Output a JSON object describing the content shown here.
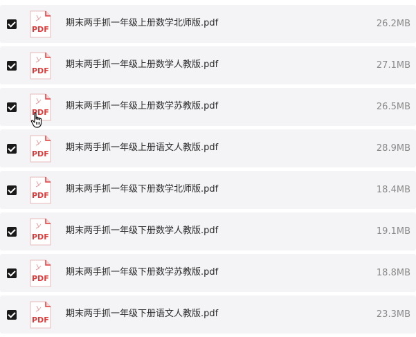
{
  "files": [
    {
      "name": "期末两手抓一年级上册数学北师版.pdf",
      "size": "26.2MB",
      "checked": true,
      "icon": "pdf-icon",
      "icon_label": "PDF"
    },
    {
      "name": "期末两手抓一年级上册数学人教版.pdf",
      "size": "27.1MB",
      "checked": true,
      "icon": "pdf-icon",
      "icon_label": "PDF"
    },
    {
      "name": "期末两手抓一年级上册数学苏教版.pdf",
      "size": "26.5MB",
      "checked": true,
      "icon": "pdf-icon",
      "icon_label": "PDF"
    },
    {
      "name": "期末两手抓一年级上册语文人教版.pdf",
      "size": "28.9MB",
      "checked": true,
      "icon": "pdf-icon",
      "icon_label": "PDF"
    },
    {
      "name": "期末两手抓一年级下册数学北师版.pdf",
      "size": "18.4MB",
      "checked": true,
      "icon": "pdf-icon",
      "icon_label": "PDF"
    },
    {
      "name": "期末两手抓一年级下册数学人教版.pdf",
      "size": "19.1MB",
      "checked": true,
      "icon": "pdf-icon",
      "icon_label": "PDF"
    },
    {
      "name": "期末两手抓一年级下册数学苏教版.pdf",
      "size": "18.8MB",
      "checked": true,
      "icon": "pdf-icon",
      "icon_label": "PDF"
    },
    {
      "name": "期末两手抓一年级下册语文人教版.pdf",
      "size": "23.3MB",
      "checked": true,
      "icon": "pdf-icon",
      "icon_label": "PDF"
    }
  ],
  "colors": {
    "row_background": "#f4f4f6",
    "checkbox": "#1a1a1a",
    "pdf_accent": "#e03b3b",
    "file_name": "#2b2b2b",
    "file_size": "#8a8a8a"
  },
  "cursor": {
    "icon": "hand-pointer-icon"
  }
}
